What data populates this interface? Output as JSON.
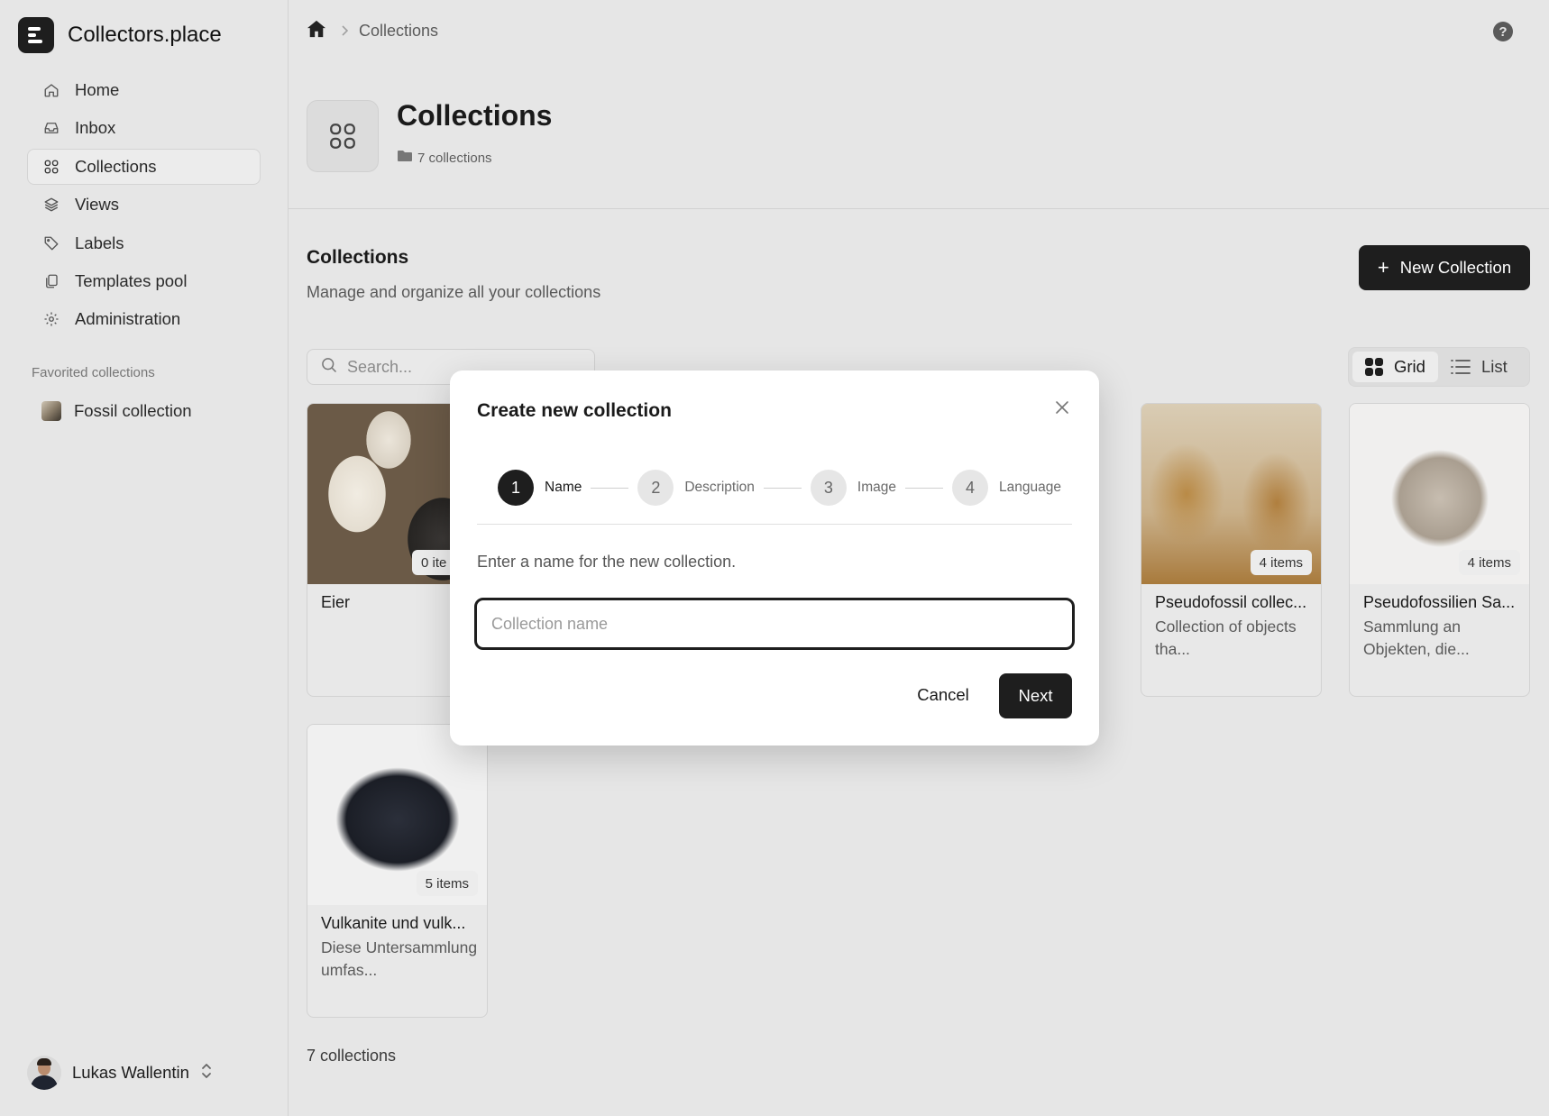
{
  "app": {
    "name": "Collectors.place"
  },
  "sidebar": {
    "items": [
      {
        "label": "Home",
        "icon": "home-icon"
      },
      {
        "label": "Inbox",
        "icon": "inbox-icon"
      },
      {
        "label": "Collections",
        "icon": "grid-icon",
        "active": true
      },
      {
        "label": "Views",
        "icon": "layers-icon"
      },
      {
        "label": "Labels",
        "icon": "tag-icon"
      },
      {
        "label": "Templates pool",
        "icon": "copy-icon"
      },
      {
        "label": "Administration",
        "icon": "gear-icon"
      }
    ],
    "favorites_heading": "Favorited collections",
    "favorites": [
      {
        "label": "Fossil collection"
      }
    ],
    "user": {
      "name": "Lukas Wallentin"
    }
  },
  "breadcrumb": {
    "current": "Collections"
  },
  "header": {
    "title": "Collections",
    "count": "7 collections"
  },
  "section": {
    "title": "Collections",
    "subtitle": "Manage and organize all your collections",
    "new_button": "New Collection"
  },
  "search": {
    "placeholder": "Search..."
  },
  "view_toggle": {
    "grid": "Grid",
    "list": "List",
    "selected": "Grid"
  },
  "cards": [
    {
      "title": "Eier",
      "desc": "",
      "badge": "0 ite"
    },
    {
      "title": "Pseudofossil collec...",
      "desc": "Collection of objects tha...",
      "badge": "4 items"
    },
    {
      "title": "Pseudofossilien Sa...",
      "desc": "Sammlung an Objekten, die...",
      "badge": "4 items"
    },
    {
      "title": "Vulkanite und vulk...",
      "desc": "Diese Untersammlung umfas...",
      "badge": "5 items"
    }
  ],
  "footer": {
    "count": "7 collections"
  },
  "modal": {
    "title": "Create new collection",
    "steps": [
      {
        "num": "1",
        "label": "Name"
      },
      {
        "num": "2",
        "label": "Description"
      },
      {
        "num": "3",
        "label": "Image"
      },
      {
        "num": "4",
        "label": "Language"
      }
    ],
    "active_step": "1",
    "hint": "Enter a name for the new collection.",
    "input": {
      "placeholder": "Collection name",
      "value": ""
    },
    "cancel_label": "Cancel",
    "next_label": "Next"
  },
  "colors": {
    "accent": "#1e1e1e",
    "background": "#e6e6e6",
    "surface": "#ffffff"
  }
}
